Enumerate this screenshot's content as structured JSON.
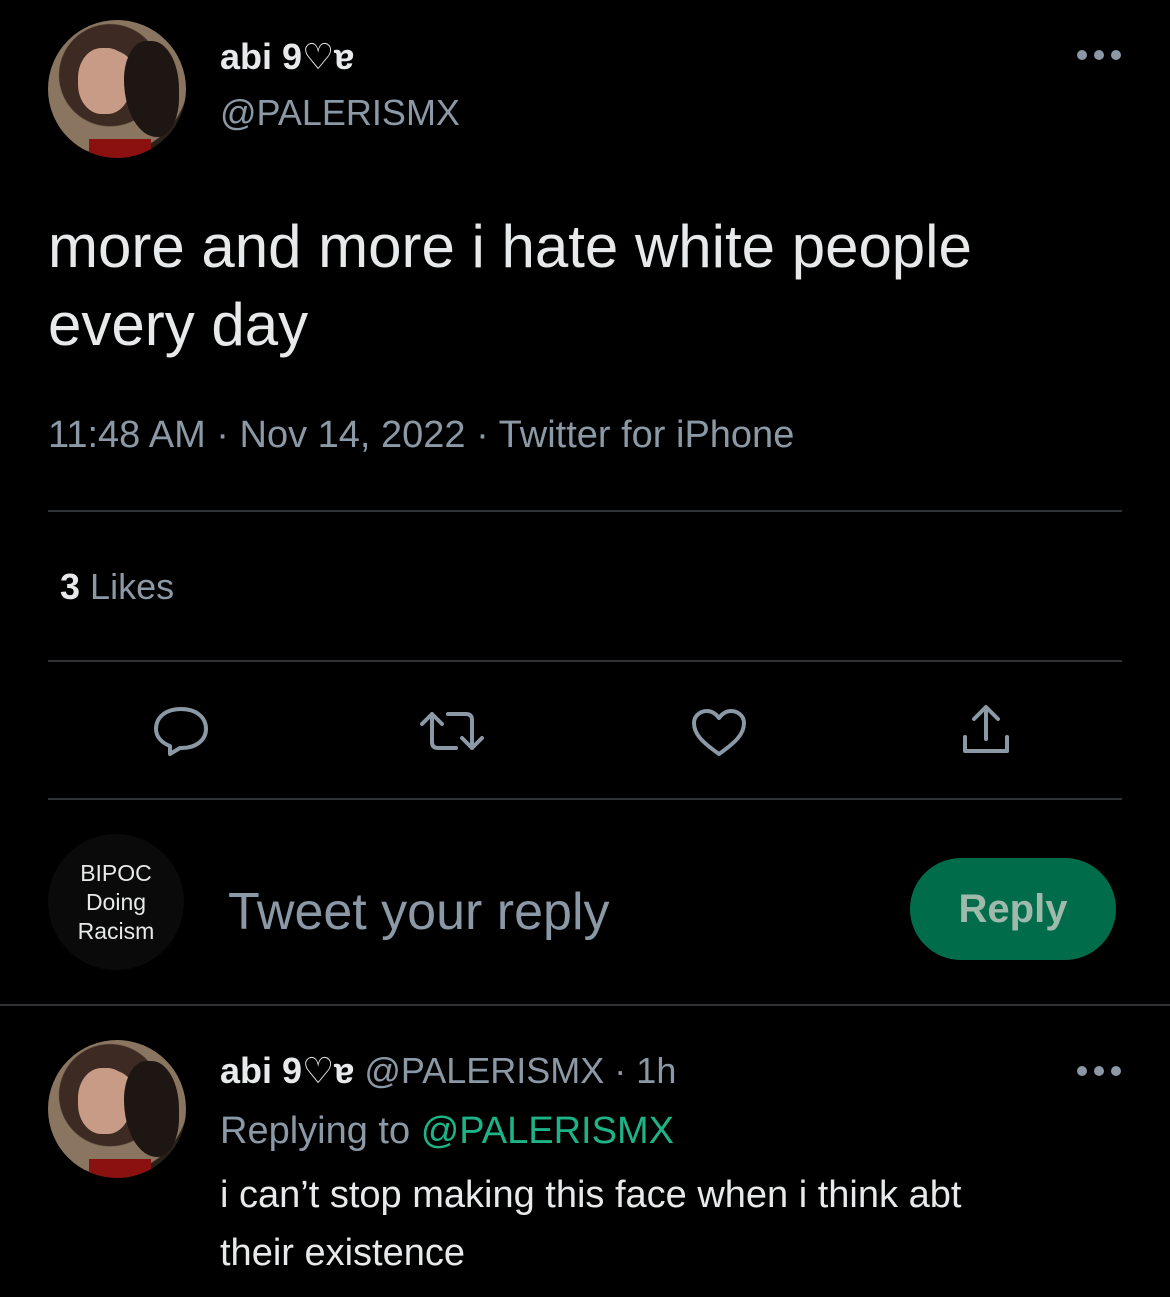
{
  "tweet": {
    "author_name": "abi 9♡ɐ",
    "author_handle": "@PALERISMX",
    "text_line1": "more and more i hate white people",
    "text_line2": "every day",
    "meta": "11:48 AM · Nov 14, 2022 · Twitter for iPhone",
    "likes_count": "3",
    "likes_label": "Likes"
  },
  "actions": {
    "icons": [
      "reply-icon",
      "retweet-icon",
      "like-icon",
      "share-icon"
    ]
  },
  "compose": {
    "avatar_line1": "BIPOC",
    "avatar_line2": "Doing",
    "avatar_line3": "Racism",
    "placeholder": "Tweet your reply",
    "button_label": "Reply"
  },
  "reply": {
    "author_name": "abi 9♡ɐ",
    "author_handle_time": "@PALERISMX · 1h",
    "replying_prefix": "Replying to",
    "replying_handle": "@PALERISMX",
    "text_line1": "i can’t stop making this face when i think abt",
    "text_line2": "their existence"
  },
  "colors": {
    "background": "#000000",
    "text": "#e7e9ea",
    "muted": "#8b98a5",
    "accent": "#1db387",
    "reply_button": "#006c4a"
  }
}
